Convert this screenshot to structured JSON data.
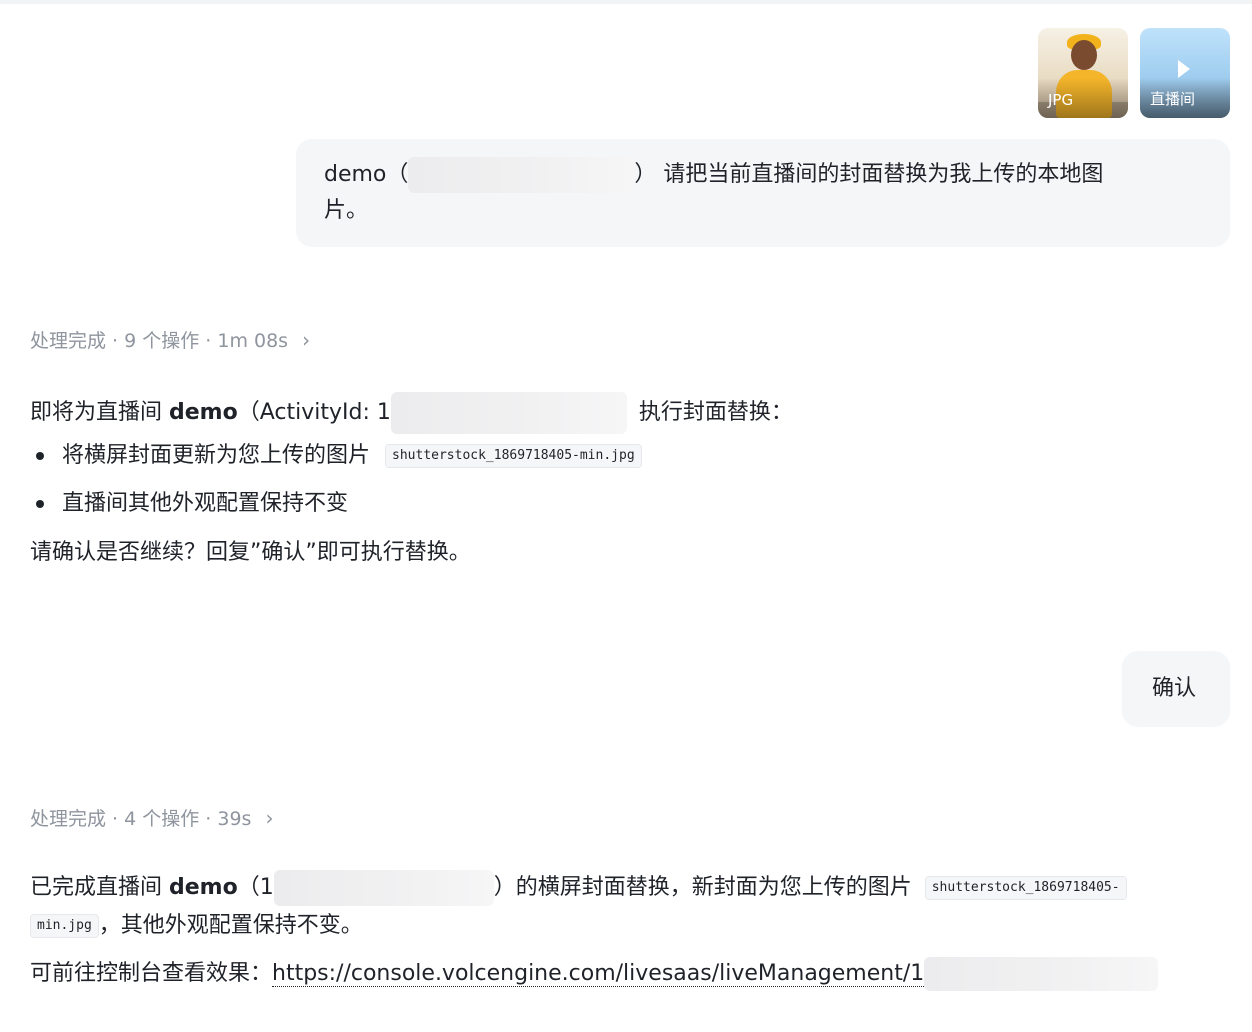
{
  "attachments": [
    {
      "label": "JPG"
    },
    {
      "label": "直播间"
    }
  ],
  "user_message_1": {
    "prefix": "demo（",
    "suffix": "） 请把当前直播间的封面替换为我上传的本地图",
    "line2": "片。"
  },
  "status_1": {
    "text": "处理完成 · 9 个操作 · 1m 08s",
    "chevron": "›"
  },
  "assistant_1": {
    "intro_prefix": "即将为直播间 ",
    "room_name": "demo",
    "intro_mid": "（ActivityId: 1",
    "intro_suffix": "执行封面替换：",
    "bullets": [
      {
        "text": "将横屏封面更新为您上传的图片",
        "code": "shutterstock_1869718405-min.jpg"
      },
      {
        "text": "直播间其他外观配置保持不变"
      }
    ],
    "confirm_prompt": "请确认是否继续？回复”确认”即可执行替换。"
  },
  "user_message_2": {
    "text": "确认"
  },
  "status_2": {
    "text": "处理完成 · 4 个操作 · 39s",
    "chevron": "›"
  },
  "assistant_2": {
    "prefix": "已完成直播间 ",
    "room_name": "demo",
    "mid": "（1",
    "suffix": "）的横屏封面替换，新封面为您上传的图片",
    "code_part1": "shutterstock_1869718405-",
    "code_part2": "min.jpg",
    "line2_suffix": "，其他外观配置保持不变。",
    "link_prefix": "可前往控制台查看效果：",
    "link_text": "https://console.volcengine.com/livesaas/liveManagement/1"
  }
}
